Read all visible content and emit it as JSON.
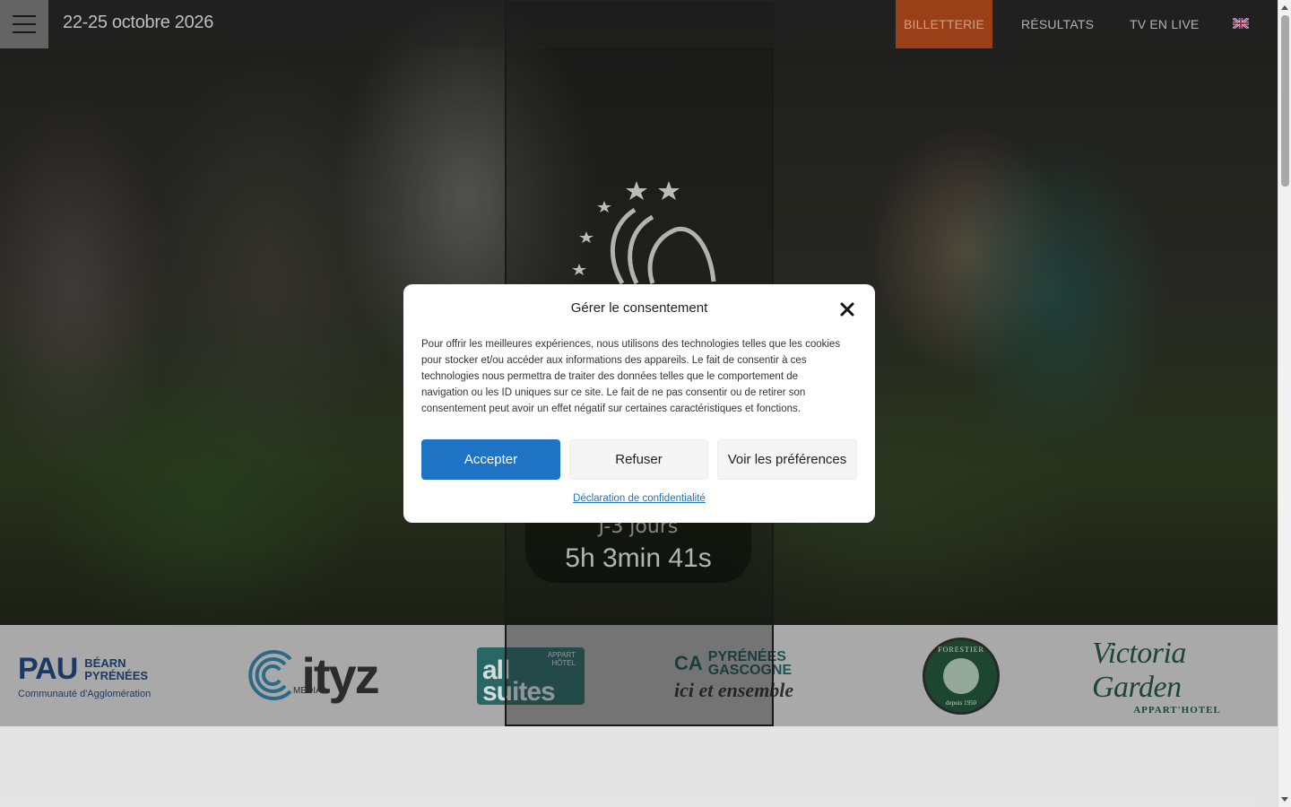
{
  "header": {
    "event_dates": "22-25 octobre 2026",
    "nav": {
      "billetterie": "BILLETTERIE",
      "resultats": "RÉSULTATS",
      "tv": "TV EN LIVE"
    },
    "language_flag": "english-flag-icon"
  },
  "hero": {
    "countdown_label": "J-3 jours",
    "countdown_value": "5h 3min 41s"
  },
  "sponsors": {
    "pau": {
      "big": "PAU",
      "side_line1": "BÉARN",
      "side_line2": "PYRÉNÉES",
      "sub": "Communauté d'Agglomération"
    },
    "cityz": {
      "word": "Cityz",
      "sub": "MEDIA"
    },
    "allsuites": {
      "word_line1": "all",
      "word_line2": "suites",
      "tag_line1": "APPART",
      "tag_line2": "HÔTEL"
    },
    "credit_agricole": {
      "logo": "CA",
      "name_line1": "PYRÉNÉES",
      "name_line2": "GASCOGNE",
      "tagline": "ici et ensemble"
    },
    "forestier": {
      "name": "FORESTIER",
      "since": "depuis 1950"
    },
    "victoria": {
      "word": "Victoria Garden",
      "sub": "APPART'HOTEL"
    }
  },
  "consent_modal": {
    "title": "Gérer le consentement",
    "body": "Pour offrir les meilleures expériences, nous utilisons des technologies telles que les cookies pour stocker et/ou accéder aux informations des appareils. Le fait de consentir à ces technologies nous permettra de traiter des données telles que le comportement de navigation ou les ID uniques sur ce site. Le fait de ne pas consentir ou de retirer son consentement peut avoir un effet négatif sur certaines caractéristiques et fonctions.",
    "accept_label": "Accepter",
    "refuse_label": "Refuser",
    "preferences_label": "Voir les préférences",
    "privacy_link": "Déclaration de confidentialité"
  },
  "colors": {
    "accent_blue": "#1f73c4",
    "billetterie_bg": "#a3441a"
  }
}
